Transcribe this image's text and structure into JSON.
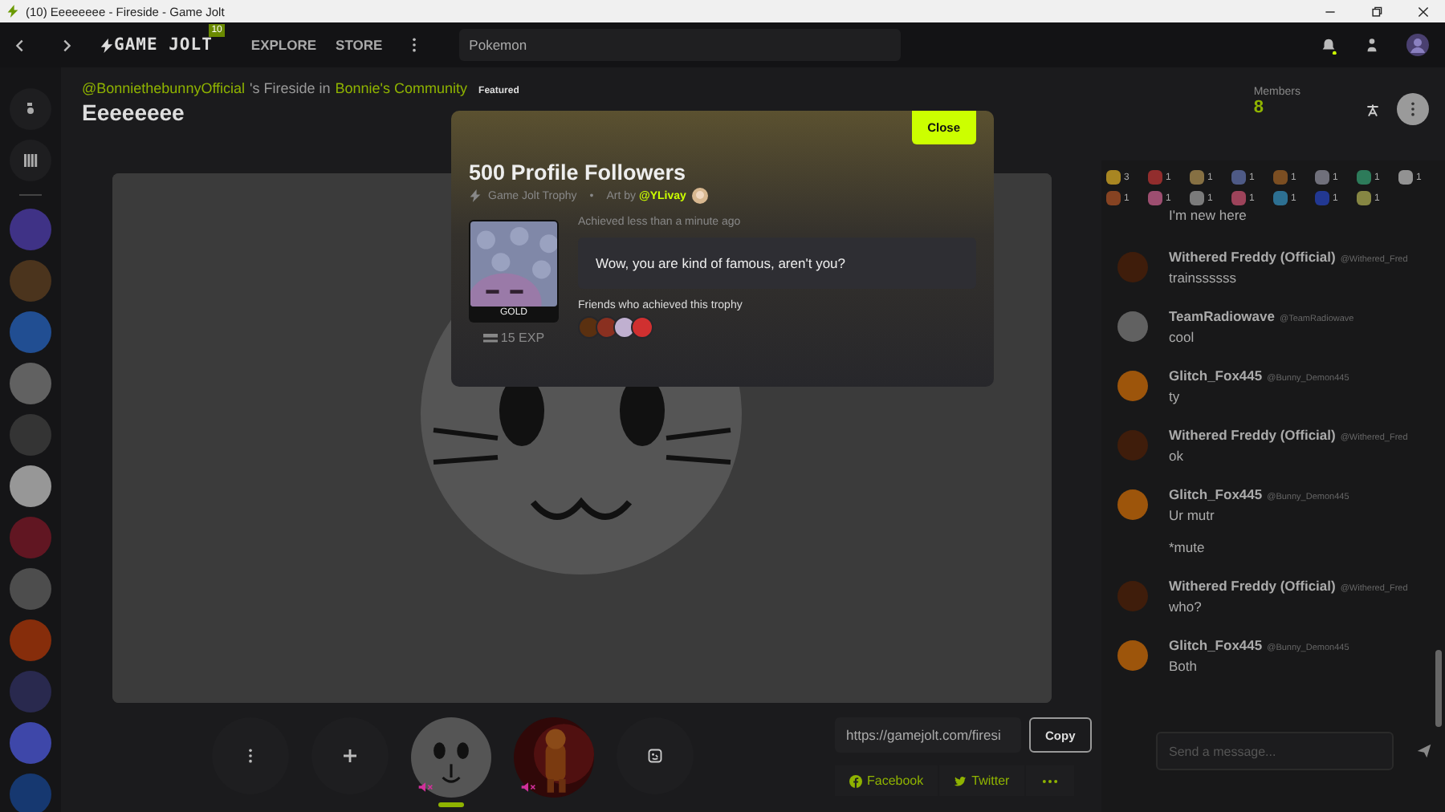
{
  "window": {
    "title": "(10) Eeeeeeee - Fireside - Game Jolt"
  },
  "nav": {
    "logo": "GAME JOLT",
    "badge": "10",
    "links": [
      {
        "label": "EXPLORE"
      },
      {
        "label": "STORE"
      }
    ],
    "search": {
      "value": "Pokemon"
    }
  },
  "sidebar": {
    "communities": [
      {
        "color": "#3f3286"
      },
      {
        "color": "#4b341d"
      },
      {
        "color": "#214e92"
      },
      {
        "color": "#616161"
      },
      {
        "color": "#343434"
      },
      {
        "color": "#979797"
      },
      {
        "color": "#611622"
      },
      {
        "color": "#4d4d4d"
      },
      {
        "color": "#862d0b"
      },
      {
        "color": "#29294e"
      },
      {
        "color": "#3e47a9"
      },
      {
        "color": "#163870"
      }
    ]
  },
  "fireside": {
    "host": "@BonniethebunnyOfficial",
    "host_suffix": "'s Fireside in",
    "community": "Bonnie's Community",
    "badge": "Featured",
    "title": "Eeeeeeee",
    "members_label": "Members",
    "members_count": "8"
  },
  "chat": {
    "reactions": [
      {
        "count": "3",
        "color": "#a88622"
      },
      {
        "count": "1",
        "color": "#922d2d"
      },
      {
        "count": "1",
        "color": "#867043"
      },
      {
        "count": "1",
        "color": "#4e5a86"
      },
      {
        "count": "1",
        "color": "#7b4e22"
      },
      {
        "count": "1",
        "color": "#70707b"
      },
      {
        "count": "1",
        "color": "#2d7b5a"
      },
      {
        "count": "1",
        "color": "#929292"
      },
      {
        "count": "1",
        "color": "#864322"
      },
      {
        "count": "1",
        "color": "#9d4e70"
      },
      {
        "count": "1",
        "color": "#7b7b7b"
      },
      {
        "count": "1",
        "color": "#9d435a"
      },
      {
        "count": "1",
        "color": "#2d7092"
      },
      {
        "count": "1",
        "color": "#223892"
      },
      {
        "count": "1",
        "color": "#868643"
      }
    ],
    "messages": [
      {
        "kind": "tail",
        "lines": [
          "I'm new here"
        ]
      },
      {
        "kind": "full",
        "name": "Withered Freddy (Official)",
        "handle": "@Withered_Fred",
        "color": "#3f1d0b",
        "lines": [
          "trainssssss"
        ]
      },
      {
        "kind": "full",
        "name": "TeamRadiowave",
        "handle": "@TeamRadiowave",
        "color": "#616161",
        "lines": [
          "cool"
        ]
      },
      {
        "kind": "full",
        "name": "Glitch_Fox445",
        "handle": "@Bunny_Demon445",
        "color": "#9d550b",
        "lines": [
          "ty"
        ]
      },
      {
        "kind": "full",
        "name": "Withered Freddy (Official)",
        "handle": "@Withered_Fred",
        "color": "#3f1d0b",
        "lines": [
          "ok"
        ]
      },
      {
        "kind": "full",
        "name": "Glitch_Fox445",
        "handle": "@Bunny_Demon445",
        "color": "#9d550b",
        "lines": [
          "Ur mutr",
          "*mute"
        ]
      },
      {
        "kind": "full",
        "name": "Withered Freddy (Official)",
        "handle": "@Withered_Fred",
        "color": "#3f1d0b",
        "lines": [
          "who?"
        ]
      },
      {
        "kind": "full",
        "name": "Glitch_Fox445",
        "handle": "@Bunny_Demon445",
        "color": "#9d550b",
        "lines": [
          "Both"
        ]
      }
    ],
    "input": {
      "placeholder": "Send a message..."
    }
  },
  "streams": [
    {
      "muted": true,
      "selected": true
    },
    {
      "muted": true,
      "selected": false
    }
  ],
  "share": {
    "url": "https://gamejolt.com/firesi",
    "copy": "Copy",
    "buttons": [
      {
        "kind": "facebook",
        "label": "Facebook"
      },
      {
        "kind": "twitter",
        "label": "Twitter"
      },
      {
        "kind": "more"
      }
    ]
  },
  "trophy": {
    "close": "Close",
    "title": "500 Profile Followers",
    "source": "Game Jolt Trophy",
    "separator": "•",
    "art_by": "Art by",
    "artist": "@YLivay",
    "level": "GOLD",
    "exp": "15 EXP",
    "achieved": "Achieved less than a minute ago",
    "quote": "Wow, you are kind of famous, aren't you?",
    "friends_label": "Friends who achieved this trophy",
    "friends": [
      {
        "color": "#5a3010"
      },
      {
        "color": "#8a3020"
      },
      {
        "color": "#c0b0d0"
      },
      {
        "color": "#d03030"
      }
    ]
  }
}
